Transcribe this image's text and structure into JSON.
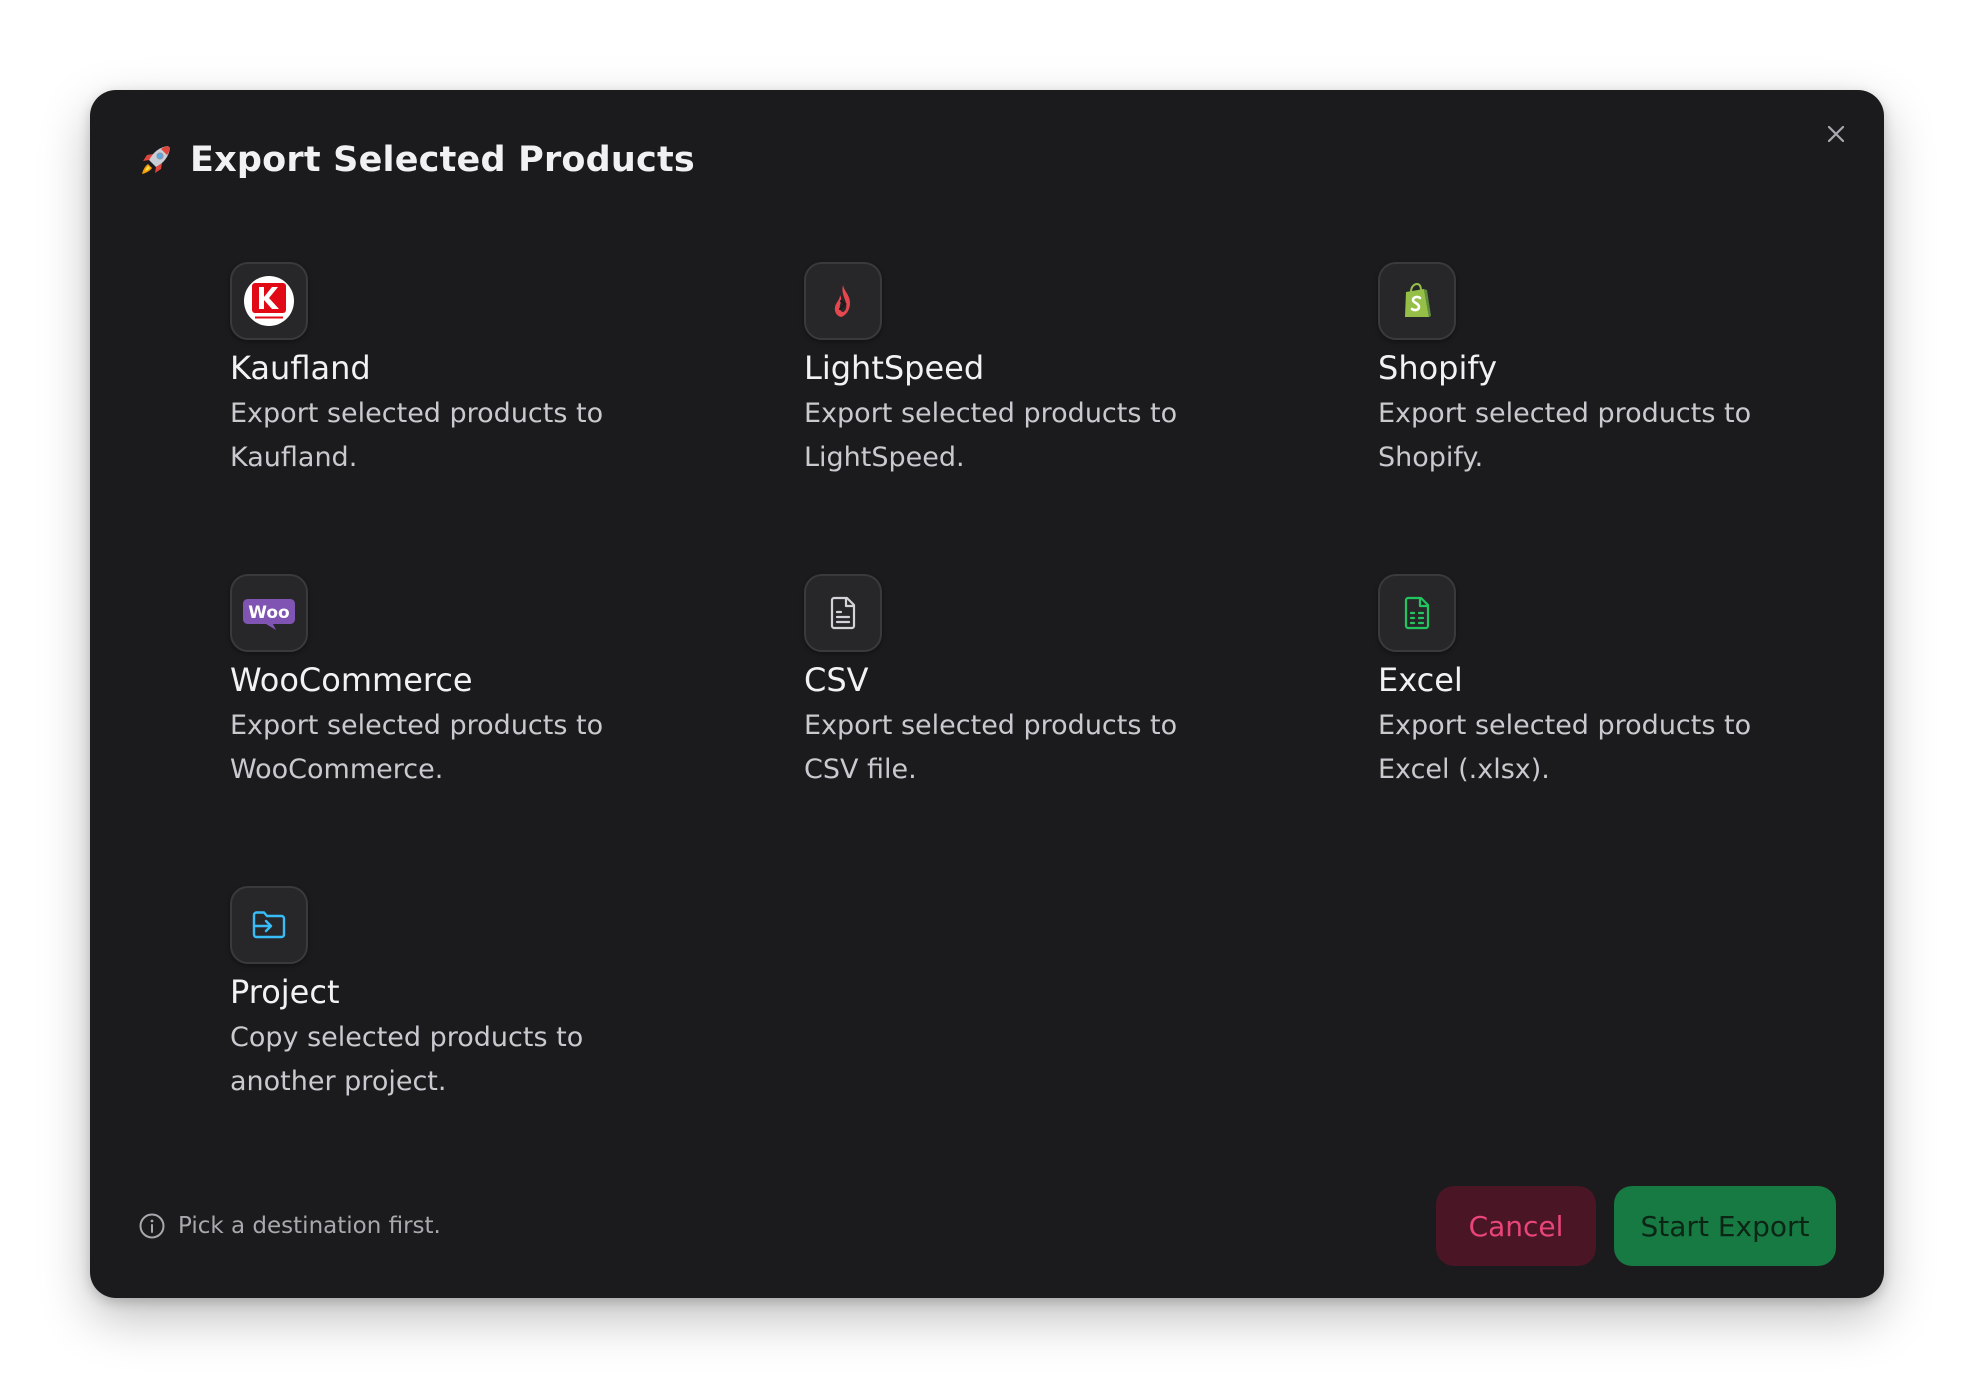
{
  "dialog": {
    "title": "Export Selected Products",
    "close_label": "×"
  },
  "destinations": [
    {
      "name": "Kaufland",
      "description": "Export selected products to Kaufland.",
      "icon": "kaufland-logo-icon",
      "color": "#e10915"
    },
    {
      "name": "LightSpeed",
      "description": "Export selected products to LightSpeed.",
      "icon": "lightspeed-flame-icon",
      "color": "#e5474f"
    },
    {
      "name": "Shopify",
      "description": "Export selected products to Shopify.",
      "icon": "shopify-bag-icon",
      "color": "#95bf47"
    },
    {
      "name": "WooCommerce",
      "description": "Export selected products to WooCommerce.",
      "icon": "woocommerce-logo-icon",
      "color": "#7f54b3"
    },
    {
      "name": "CSV",
      "description": "Export selected products to CSV file.",
      "icon": "file-text-icon",
      "color": "#d4d4d8"
    },
    {
      "name": "Excel",
      "description": "Export selected products to Excel (.xlsx).",
      "icon": "spreadsheet-file-icon",
      "color": "#22c55e"
    },
    {
      "name": "Project",
      "description": "Copy selected products to another project.",
      "icon": "folder-import-icon",
      "color": "#38bdf8"
    }
  ],
  "footer": {
    "hint": "Pick a destination first.",
    "cancel_label": "Cancel",
    "start_label": "Start Export"
  }
}
